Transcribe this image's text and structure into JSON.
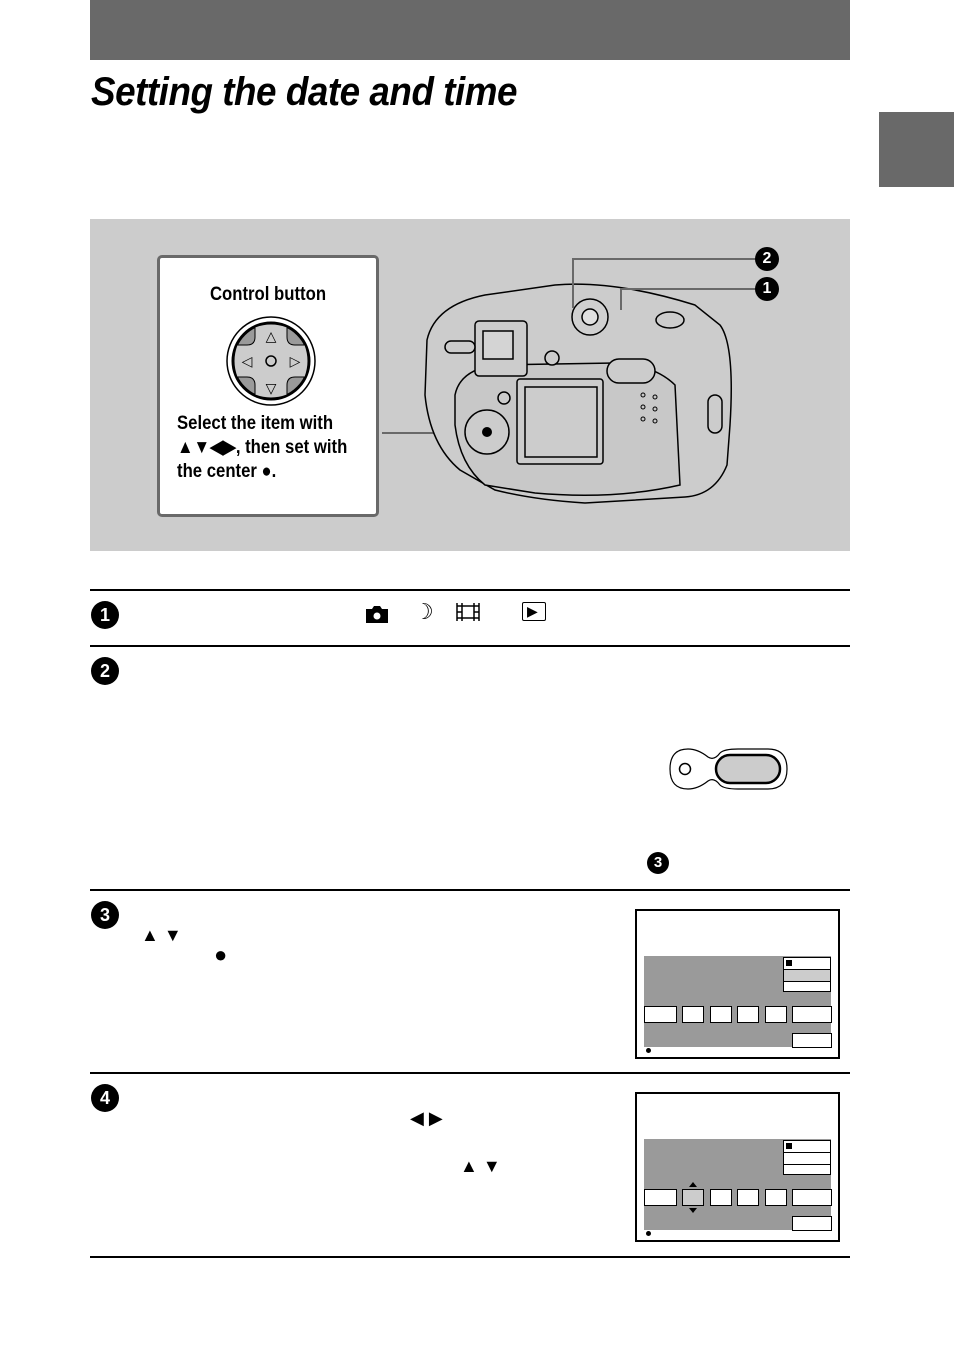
{
  "page": {
    "title": "Setting the date and time",
    "colors": {
      "header_bar": "#696969",
      "illustration_bg": "#cccccc",
      "screen_panel": "#9a9a9a",
      "selected_field": "#cccccc"
    }
  },
  "illustration": {
    "callout": {
      "title": "Control button",
      "text_lines": [
        "Select the item with",
        "▲▼◀▶, then set with",
        "the center ●."
      ],
      "pad_arrows": {
        "up": "△",
        "down": "▽",
        "left": "◁",
        "right": "▷",
        "center": "○"
      }
    },
    "camera_labels": [
      "2",
      "1"
    ]
  },
  "steps": [
    {
      "number": "1",
      "icons": [
        "camera-icon",
        "night-mode-icon",
        "movie-icon",
        "playback-icon"
      ],
      "glyphs": {
        "moon": "☽",
        "play": "▶"
      }
    },
    {
      "number": "2",
      "reference_step": "3"
    },
    {
      "number": "3",
      "arrows": "▲ ▼",
      "center": "●",
      "screen": {
        "selected_menu_row": 2,
        "selected_field": null,
        "fields": 6
      }
    },
    {
      "number": "4",
      "arrows_lr": "◀ ▶",
      "arrows_ud": "▲ ▼",
      "screen": {
        "selected_menu_row": null,
        "selected_field": 2,
        "fields": 6
      }
    }
  ]
}
